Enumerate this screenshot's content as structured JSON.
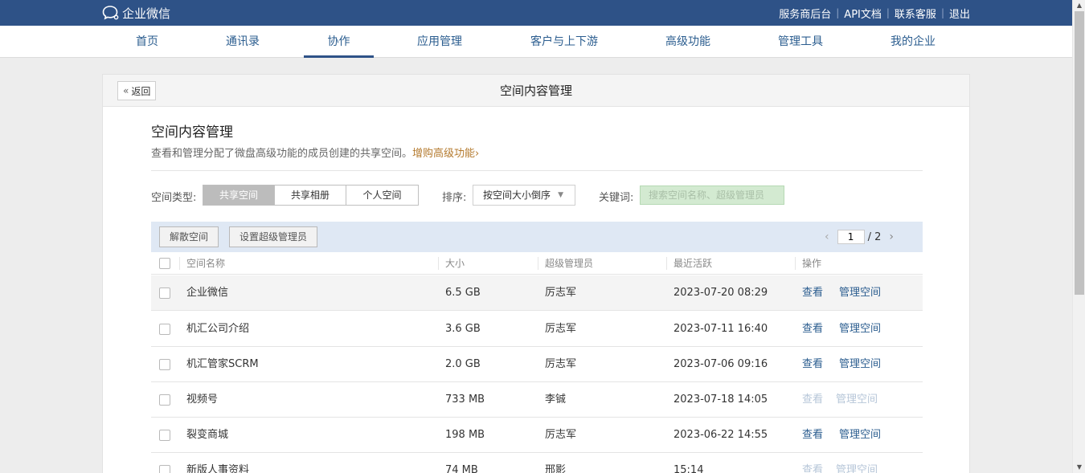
{
  "header": {
    "logo_text": "企业微信",
    "links": [
      "服务商后台",
      "API文档",
      "联系客服",
      "退出"
    ]
  },
  "nav": {
    "items": [
      "首页",
      "通讯录",
      "协作",
      "应用管理",
      "客户与上下游",
      "高级功能",
      "管理工具",
      "我的企业"
    ],
    "active": "协作"
  },
  "panel": {
    "back_label": "返回",
    "title": "空间内容管理"
  },
  "section": {
    "title": "空间内容管理",
    "desc": "查看和管理分配了微盘高级功能的成员创建的共享空间。",
    "link": "增购高级功能"
  },
  "filters": {
    "type_label": "空间类型:",
    "types": [
      "共享空间",
      "共享相册",
      "个人空间"
    ],
    "active_type": "共享空间",
    "sort_label": "排序:",
    "sort_value": "按空间大小倒序",
    "keyword_label": "关键词:",
    "keyword_placeholder": "搜索空间名称、超级管理员"
  },
  "toolbar": {
    "dissolve": "解散空间",
    "set_admin": "设置超级管理员",
    "page_current": "1",
    "page_total": "/ 2"
  },
  "table": {
    "columns": [
      "空间名称",
      "大小",
      "超级管理员",
      "最近活跃",
      "操作"
    ],
    "view_label": "查看",
    "manage_label": "管理空间",
    "rows": [
      {
        "name": "企业微信",
        "size": "6.5 GB",
        "admin": "厉志军",
        "active": "2023-07-20 08:29",
        "enabled": true
      },
      {
        "name": "机汇公司介绍",
        "size": "3.6 GB",
        "admin": "厉志军",
        "active": "2023-07-11 16:40",
        "enabled": true
      },
      {
        "name": "机汇管家SCRM",
        "size": "2.0 GB",
        "admin": "厉志军",
        "active": "2023-07-06 09:16",
        "enabled": true
      },
      {
        "name": "视频号",
        "size": "733 MB",
        "admin": "李铖",
        "active": "2023-07-18 14:05",
        "enabled": false
      },
      {
        "name": "裂变商城",
        "size": "198 MB",
        "admin": "厉志军",
        "active": "2023-06-22 14:55",
        "enabled": true
      },
      {
        "name": "新版人事资料",
        "size": "74 MB",
        "admin": "邢影",
        "active": "15:14",
        "enabled": false
      }
    ]
  },
  "colors": {
    "topbar": "#2e5287",
    "link": "#2b5d8f",
    "accent_link": "#b47a2e",
    "toolbar_bg": "#dfe8f4"
  }
}
